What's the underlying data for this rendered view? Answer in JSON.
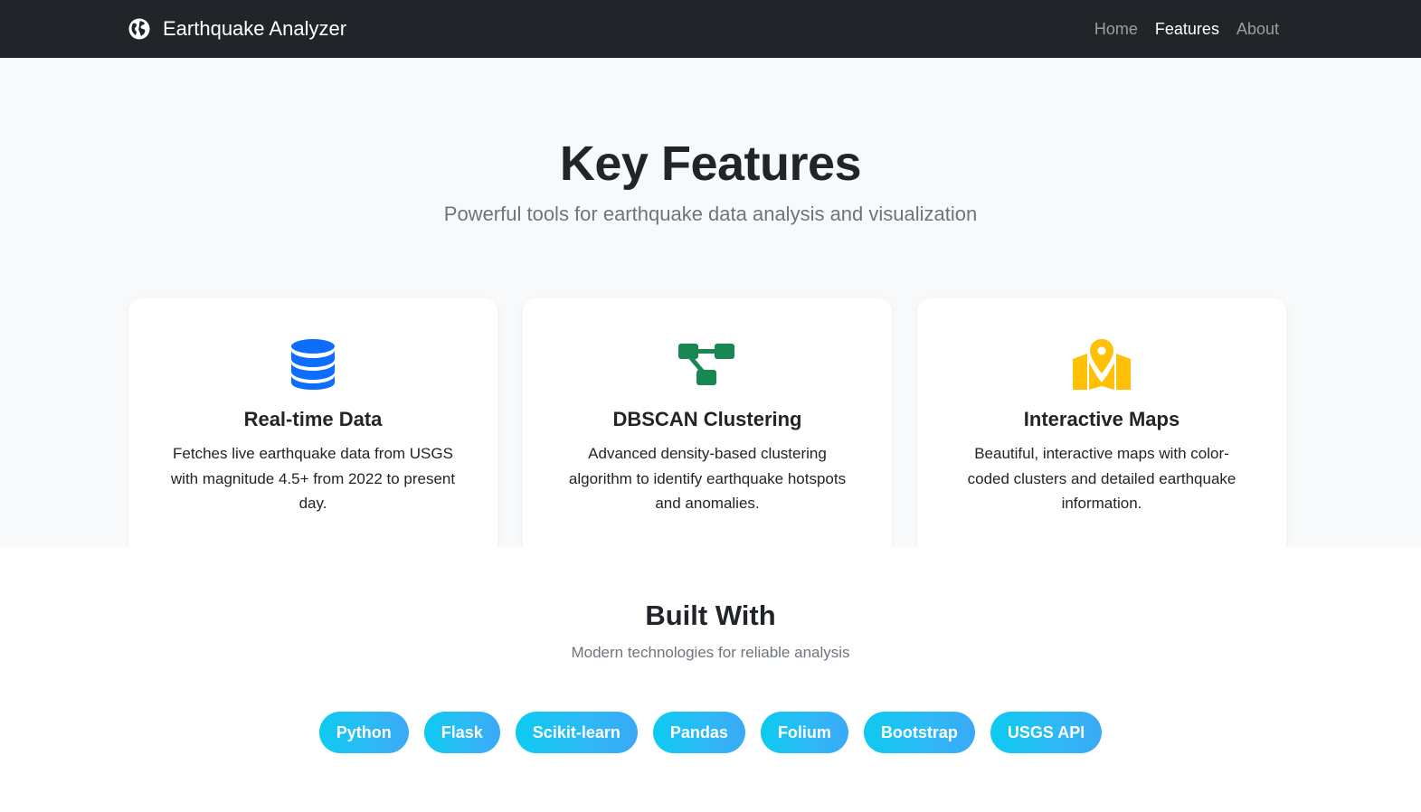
{
  "navbar": {
    "brand": "Earthquake Analyzer",
    "links": [
      {
        "label": "Home",
        "active": false
      },
      {
        "label": "Features",
        "active": true
      },
      {
        "label": "About",
        "active": false
      }
    ]
  },
  "features": {
    "title": "Key Features",
    "subtitle": "Powerful tools for earthquake data analysis and visualization",
    "cards": [
      {
        "icon": "database-icon",
        "color": "#0d6efd",
        "title": "Real-time Data",
        "text": "Fetches live earthquake data from USGS with magnitude 4.5+ from 2022 to present day."
      },
      {
        "icon": "diagram-icon",
        "color": "#198754",
        "title": "DBSCAN Clustering",
        "text": "Advanced density-based clustering algorithm to identify earthquake hotspots and anomalies."
      },
      {
        "icon": "map-pin-icon",
        "color": "#ffc107",
        "title": "Interactive Maps",
        "text": "Beautiful, interactive maps with color-coded clusters and detailed earthquake information."
      }
    ]
  },
  "built": {
    "title": "Built With",
    "subtitle": "Modern technologies for reliable analysis",
    "badges": [
      "Python",
      "Flask",
      "Scikit-learn",
      "Pandas",
      "Folium",
      "Bootstrap",
      "USGS API"
    ]
  }
}
